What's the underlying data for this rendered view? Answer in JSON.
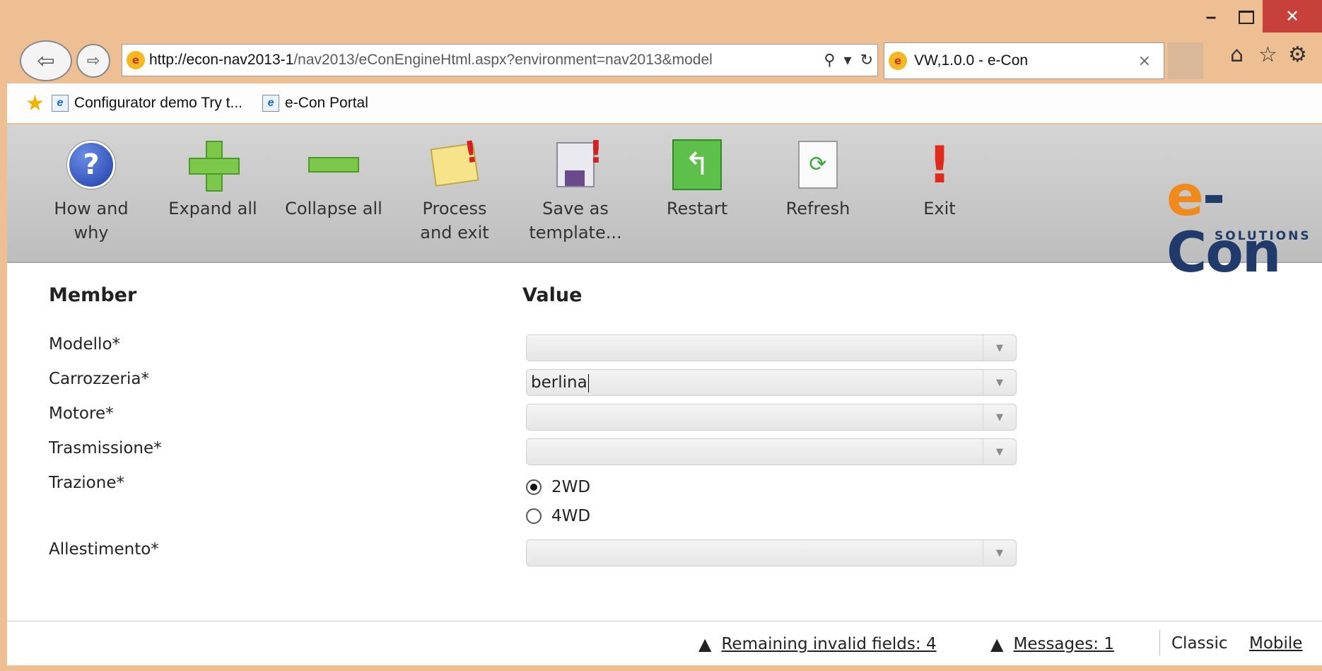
{
  "browser": {
    "minimize_glyph": "‒",
    "close_glyph": "✕",
    "back_glyph": "⇦",
    "forward_glyph": "⇨",
    "url_host": "http://econ-nav2013-1",
    "url_rest": "/nav2013/eConEngineHtml.aspx?environment=nav2013&model",
    "search_glyph": "⚲",
    "dropdown_glyph": "▾",
    "refresh_glyph": "↻",
    "tab_title": "VW,1.0.0 - e-Con",
    "tab_close": "×",
    "home_glyph": "⌂",
    "favorites_glyph": "☆",
    "tools_glyph": "⚙",
    "site_icon_glyph": "e",
    "favorites_bar_star": "★",
    "favorites": [
      {
        "label": "Configurator demo  Try t..."
      },
      {
        "label": "e-Con Portal"
      }
    ],
    "ie_icon_glyph": "e"
  },
  "toolbar": {
    "buttons": [
      {
        "label": "How and\nwhy",
        "icon": "help-icon"
      },
      {
        "label": "Expand all",
        "icon": "plus-icon"
      },
      {
        "label": "Collapse all",
        "icon": "minus-icon"
      },
      {
        "label": "Process\nand exit",
        "icon": "note-icon"
      },
      {
        "label": "Save as\ntemplate...",
        "icon": "save-icon"
      },
      {
        "label": "Restart",
        "icon": "restart-icon"
      },
      {
        "label": "Refresh",
        "icon": "refresh-icon"
      },
      {
        "label": "Exit",
        "icon": "exit-icon"
      }
    ],
    "help_glyph": "?",
    "restart_glyph": "↰",
    "refresh_glyph": "⟳",
    "exit_glyph": "!"
  },
  "logo": {
    "e": "e",
    "con": "-Con",
    "sub": "SOLUTIONS"
  },
  "form": {
    "member_header": "Member",
    "value_header": "Value",
    "rows": [
      {
        "label": "Modello*",
        "value": ""
      },
      {
        "label": "Carrozzeria*",
        "value": "berlina"
      },
      {
        "label": "Motore*",
        "value": ""
      },
      {
        "label": "Trasmissione*",
        "value": ""
      },
      {
        "label": "Trazione*"
      },
      {
        "label": "Allestimento*",
        "value": ""
      }
    ],
    "trazione_options": [
      {
        "label": "2WD",
        "selected": true
      },
      {
        "label": "4WD",
        "selected": false
      }
    ],
    "combo_arrow": "▼"
  },
  "status": {
    "warn_glyph": "▲",
    "remaining": "Remaining invalid fields: 4",
    "messages": "Messages: 1",
    "classic": "Classic",
    "mobile": "Mobile"
  },
  "colors": {
    "window_frame": "#eebf92",
    "close_button": "#c7403a",
    "toolbar_bg": "#c8c8c8",
    "logo_orange": "#f08a1c",
    "logo_navy": "#1f3a6b"
  }
}
